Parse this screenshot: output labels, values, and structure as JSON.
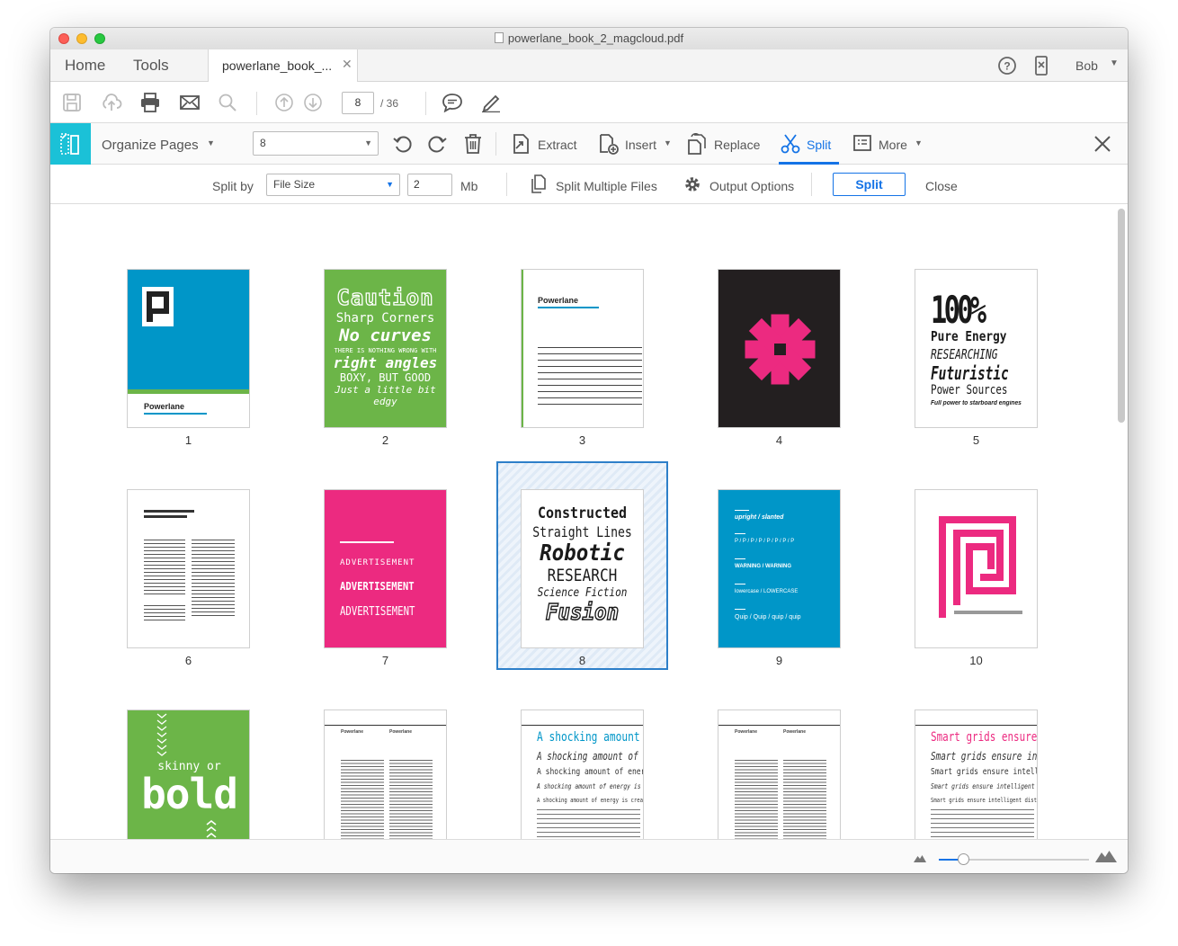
{
  "window": {
    "title": "powerlane_book_2_magcloud.pdf"
  },
  "tabs": {
    "home": "Home",
    "tools": "Tools",
    "document": "powerlane_book_...",
    "close": "✕"
  },
  "user": {
    "name": "Bob"
  },
  "toolbar": {
    "page_current": "8",
    "page_total": "/ 36"
  },
  "organize": {
    "title": "Organize Pages",
    "page_select": "8",
    "extract": "Extract",
    "insert": "Insert",
    "replace": "Replace",
    "split": "Split",
    "more": "More"
  },
  "split_bar": {
    "split_by_label": "Split by",
    "split_by_value": "File Size",
    "size_value": "2",
    "unit": "Mb",
    "split_multiple": "Split Multiple Files",
    "output_options": "Output Options",
    "split_button": "Split",
    "close": "Close"
  },
  "pages": [
    {
      "num": "1"
    },
    {
      "num": "2"
    },
    {
      "num": "3"
    },
    {
      "num": "4"
    },
    {
      "num": "5"
    },
    {
      "num": "6"
    },
    {
      "num": "7"
    },
    {
      "num": "8"
    },
    {
      "num": "9"
    },
    {
      "num": "10"
    }
  ],
  "thumb_text": {
    "p1": {
      "title": "Powerlane"
    },
    "p2": {
      "l1": "Caution",
      "l2": "Sharp Corners",
      "l3": "No curves",
      "l4": "THERE IS NOTHING WRONG WITH",
      "l5": "right angles",
      "l6": "BOXY, BUT GOOD",
      "l7": "Just a little bit edgy"
    },
    "p3": {
      "title": "Powerlane"
    },
    "p5": {
      "l1": "100%",
      "l2": "Pure Energy",
      "l3": "RESEARCHING",
      "l4": "Futuristic",
      "l5": "Power Sources",
      "l6": "Full power to starboard engines"
    },
    "p7": {
      "l1": "ADVERTISEMENT",
      "l2": "ADVERTISEMENT",
      "l3": "ADVERTISEMENT"
    },
    "p8": {
      "l1": "Constructed",
      "l2": "Straight Lines",
      "l3": "Robotic",
      "l4": "RESEARCH",
      "l5": "Science Fiction",
      "l6": "Fusion"
    },
    "p9": {
      "l1": "upright / slanted",
      "l2": "P / P / P / P / P / P / P / P",
      "l3": "WARNING / WARNING",
      "l4": "lowercase / LOWERCASE",
      "l5": "Quip / Quip / quip / quip"
    },
    "p11": {
      "l1": "skinny or",
      "l2": "bold"
    },
    "p12": {
      "col1": "Powerlane",
      "col2": "Powerlane"
    },
    "p13": {
      "l1": "A shocking amount",
      "l2": "A shocking amount of e",
      "l3": "A shocking amount of energy",
      "l4": "A shocking amount of energy is create",
      "l5": "A shocking amount of energy is created by hep"
    },
    "p14": {
      "col1": "Powerlane",
      "col2": "Powerlane"
    },
    "p15": {
      "l1": "Smart grids ensure",
      "l2": "Smart grids ensure inte",
      "l3": "Smart grids ensure intelligen",
      "l4": "Smart grids ensure intelligent distribu",
      "l5": "Smart grids ensure intelligent distribution of po"
    }
  },
  "colors": {
    "accent": "#1473e6",
    "teal": "#1bc1d7",
    "blue_page": "#0096c8",
    "green_page": "#6cb548",
    "pink": "#ec2a80",
    "dark_page": "#231f20"
  },
  "zoom": {
    "level": 0.16
  }
}
